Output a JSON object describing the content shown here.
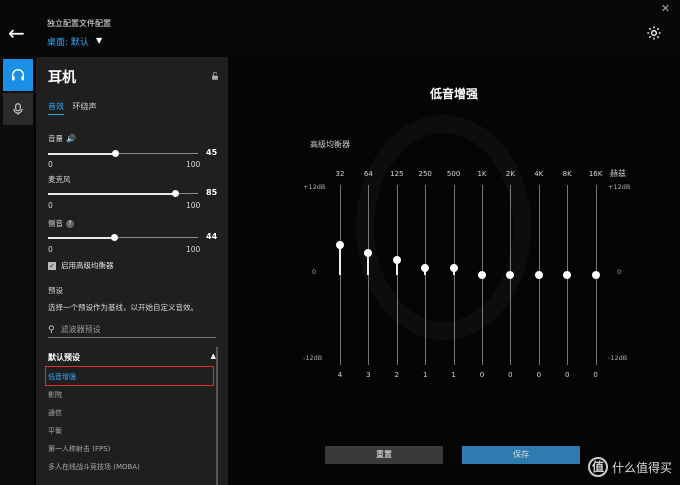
{
  "topbar": {
    "profile_label": "独立配置文件配置",
    "profile_value": "桌面: 默认"
  },
  "panel": {
    "title": "耳机",
    "tabs": [
      {
        "label": "音效",
        "active": true
      },
      {
        "label": "环绕声",
        "active": false
      }
    ],
    "sliders": [
      {
        "label": "音量",
        "value": "45",
        "min": "0",
        "max": "100",
        "level": 0.45
      },
      {
        "label": "麦克风",
        "value": "85",
        "min": "0",
        "max": "100",
        "level": 0.85
      },
      {
        "label": "侧音",
        "value": "44",
        "min": "0",
        "max": "100",
        "level": 0.44
      }
    ],
    "advanced_eq_label": "启用高级均衡器",
    "preset_heading": "预设",
    "preset_desc": "选择一个预设作为基线，以开始自定义音效。",
    "search_placeholder": "滤波器预设",
    "list_heading": "默认预设",
    "presets": [
      "低音增强",
      "影院",
      "通信",
      "平衡",
      "第一人称射击 (FPS)",
      "多人在线战斗竞技场 (MOBA)"
    ]
  },
  "eq": {
    "title": "低音增强",
    "label": "高级均衡器",
    "unit": "赫兹",
    "scale_top": "+12dB",
    "scale_mid": "0",
    "scale_bottom": "-12dB",
    "reset_label": "重置",
    "save_label": "保存"
  },
  "chart_data": {
    "type": "bar",
    "categories": [
      "32",
      "64",
      "125",
      "250",
      "500",
      "1K",
      "2K",
      "4K",
      "8K",
      "16K"
    ],
    "values": [
      4,
      3,
      2,
      1,
      1,
      0,
      0,
      0,
      0,
      0
    ],
    "ylim": [
      -12,
      12
    ]
  },
  "watermark": "什么值得买",
  "colors": {
    "accent": "#2ea8ff",
    "highlight_box": "#e0302a",
    "save": "#2e7bb0"
  }
}
